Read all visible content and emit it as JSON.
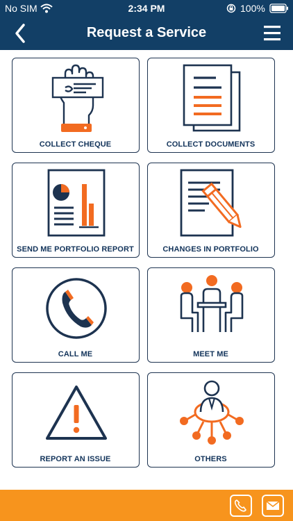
{
  "status_bar": {
    "carrier": "No SIM",
    "time": "2:34 PM",
    "battery": "100%",
    "icons": [
      "wifi-icon",
      "orientation-lock-icon",
      "battery-icon"
    ]
  },
  "header": {
    "title": "Request a Service",
    "back_icon": "chevron-left-icon",
    "menu_icon": "hamburger-menu-icon"
  },
  "services": [
    {
      "label": "COLLECT CHEQUE",
      "icon": "hand-holding-cheque-icon"
    },
    {
      "label": "COLLECT DOCUMENTS",
      "icon": "documents-icon"
    },
    {
      "label": "SEND ME PORTFOLIO REPORT",
      "icon": "portfolio-report-icon"
    },
    {
      "label": "CHANGES IN PORTFOLIO",
      "icon": "edit-document-icon"
    },
    {
      "label": "CALL ME",
      "icon": "phone-icon"
    },
    {
      "label": "MEET ME",
      "icon": "meeting-icon"
    },
    {
      "label": "REPORT AN ISSUE",
      "icon": "warning-icon"
    },
    {
      "label": "OTHERS",
      "icon": "person-network-icon"
    }
  ],
  "footer": {
    "icons": [
      "phone-icon",
      "mail-icon"
    ]
  },
  "colors": {
    "navy": "#123f66",
    "orange": "#f7941d",
    "icon_dark": "#1d3350",
    "icon_orange": "#f26b21"
  }
}
